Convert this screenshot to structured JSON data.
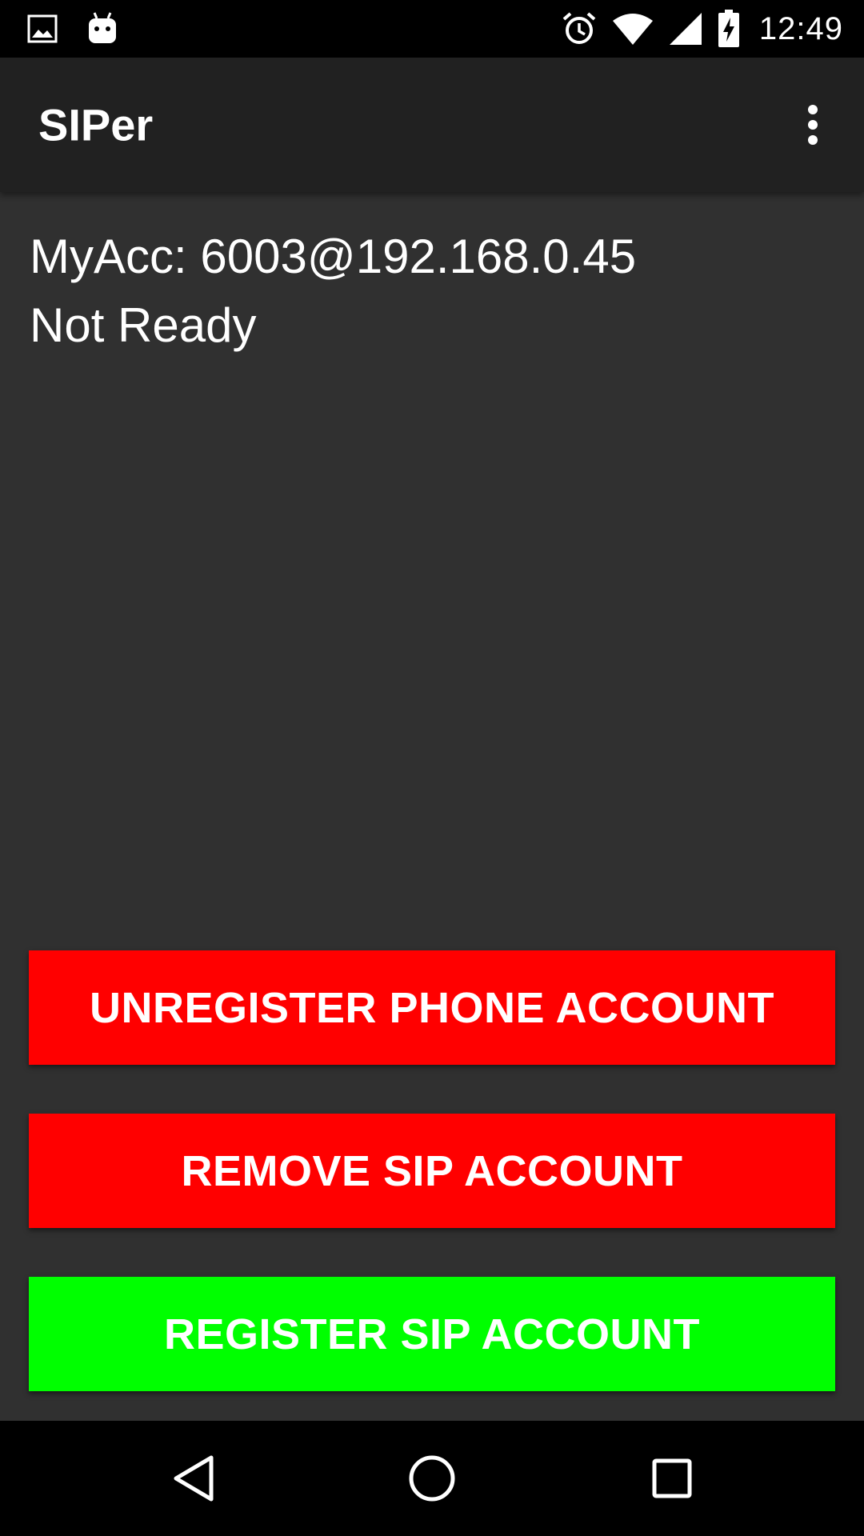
{
  "status_bar": {
    "time": "12:49",
    "icons": [
      "gallery-icon",
      "android-icon",
      "alarm-icon",
      "wifi-icon",
      "cell-signal-icon",
      "battery-charging-icon"
    ]
  },
  "app_bar": {
    "title": "SIPer",
    "menu_icon": "overflow-menu-icon"
  },
  "account": {
    "label_line": "MyAcc: 6003@192.168.0.45",
    "status": "Not Ready"
  },
  "buttons": {
    "unregister_phone": "UNREGISTER PHONE ACCOUNT",
    "remove_sip": "REMOVE SIP ACCOUNT",
    "register_sip": "REGISTER SIP ACCOUNT"
  },
  "colors": {
    "danger": "#ff0000",
    "success": "#00ff00",
    "background": "#303030",
    "app_bar": "#212121"
  },
  "nav_bar": {
    "icons": [
      "back-icon",
      "home-icon",
      "recents-icon"
    ]
  }
}
